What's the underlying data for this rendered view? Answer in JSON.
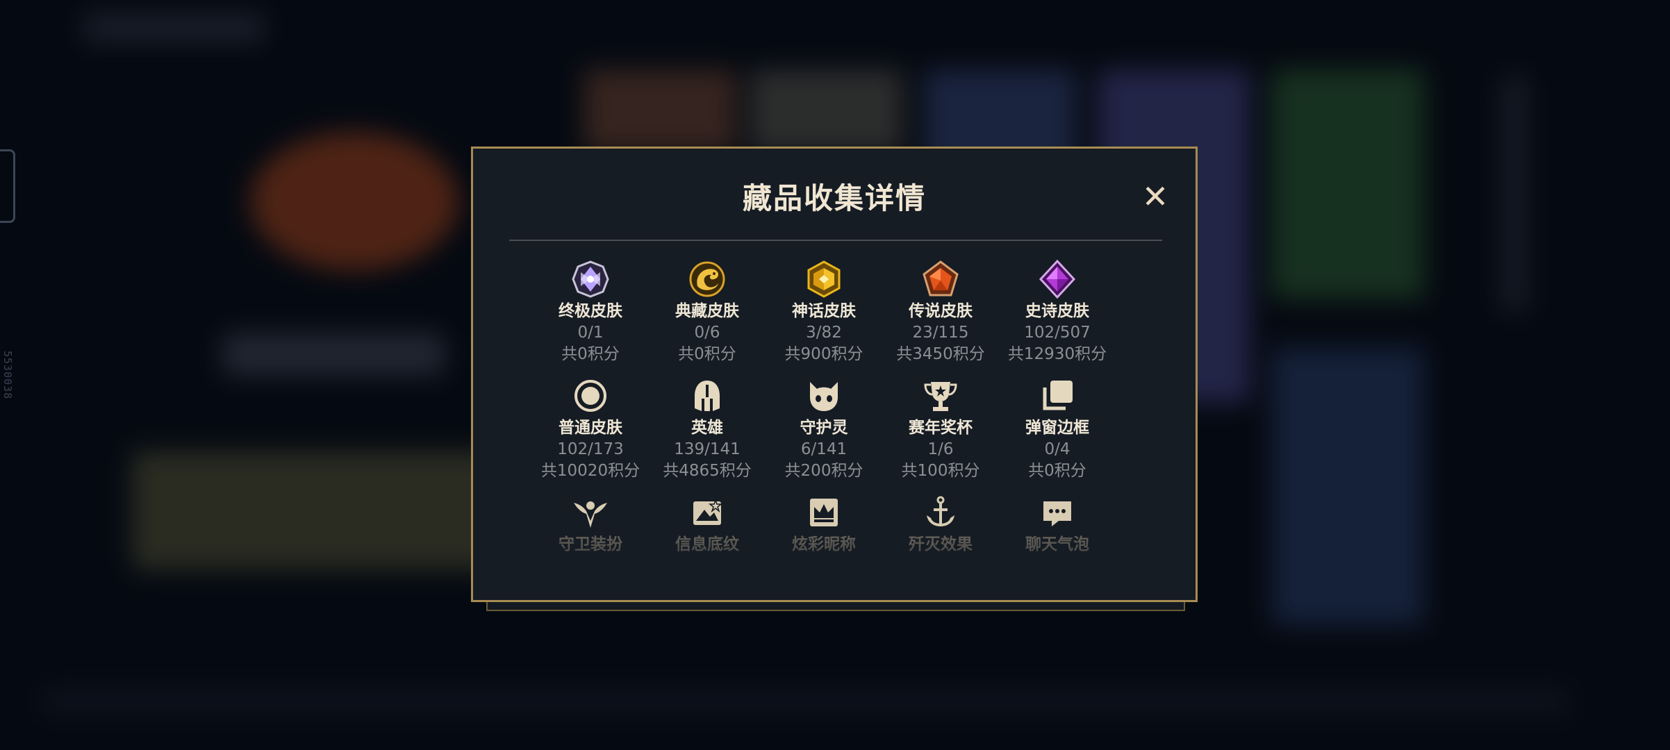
{
  "modal": {
    "title": "藏品收集详情",
    "close_label": "✕"
  },
  "side_code": "5530038",
  "items": [
    {
      "name": "终极皮肤",
      "count": "0/1",
      "points": "共0积分",
      "icon": "ultimate-skin-gem-icon",
      "color": "#b9a3ff"
    },
    {
      "name": "典藏皮肤",
      "count": "0/6",
      "points": "共0积分",
      "icon": "prestige-dragon-icon",
      "color": "#d9a328"
    },
    {
      "name": "神话皮肤",
      "count": "3/82",
      "points": "共900积分",
      "icon": "mythic-gem-icon",
      "color": "#e8b51a"
    },
    {
      "name": "传说皮肤",
      "count": "23/115",
      "points": "共3450积分",
      "icon": "legendary-gem-icon",
      "color": "#e4551c"
    },
    {
      "name": "史诗皮肤",
      "count": "102/507",
      "points": "共12930积分",
      "icon": "epic-gem-icon",
      "color": "#b23ad6"
    },
    {
      "name": "普通皮肤",
      "count": "102/173",
      "points": "共10020积分",
      "icon": "regular-skin-ring-icon",
      "color": "#e4d8bf"
    },
    {
      "name": "英雄",
      "count": "139/141",
      "points": "共4865积分",
      "icon": "champion-helmet-icon",
      "color": "#e4d8bf"
    },
    {
      "name": "守护灵",
      "count": "6/141",
      "points": "共200积分",
      "icon": "guardian-spirit-icon",
      "color": "#e4d8bf"
    },
    {
      "name": "赛年奖杯",
      "count": "1/6",
      "points": "共100积分",
      "icon": "season-trophy-icon",
      "color": "#e4d8bf"
    },
    {
      "name": "弹窗边框",
      "count": "0/4",
      "points": "共0积分",
      "icon": "popup-frame-icon",
      "color": "#e4d8bf"
    },
    {
      "name": "守卫装扮",
      "icon": "ward-skin-icon",
      "color": "#d8ccb2"
    },
    {
      "name": "信息底纹",
      "icon": "banner-icon",
      "color": "#d8ccb2"
    },
    {
      "name": "炫彩昵称",
      "icon": "crown-nameplate-icon",
      "color": "#d8ccb2"
    },
    {
      "name": "歼灭效果",
      "icon": "anchor-effect-icon",
      "color": "#d8ccb2"
    },
    {
      "name": "聊天气泡",
      "icon": "chat-bubble-icon",
      "color": "#d8ccb2"
    }
  ]
}
